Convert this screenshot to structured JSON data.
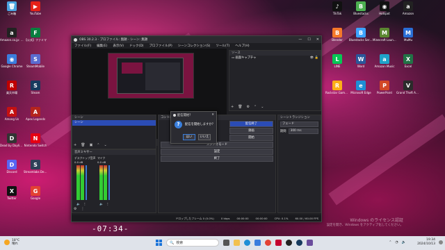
{
  "desktop": {
    "left_icons": [
      {
        "label": "ごみ箱",
        "color": "#4aa3df",
        "glyph": "🗑"
      },
      {
        "label": "YouTube",
        "color": "#e62117",
        "glyph": "▶"
      },
      {
        "label": "Amazon.co.jp: 暮らし",
        "color": "#222",
        "glyph": "a"
      },
      {
        "label": "【公式】ファミマ",
        "color": "#0a7f3f",
        "glyph": "F"
      },
      {
        "label": "Google Chrome",
        "color": "#3b7ddd",
        "glyph": "◉"
      },
      {
        "label": "SteamMobile",
        "color": "#5a6bd0",
        "glyph": "S"
      },
      {
        "label": "楽天市場",
        "color": "#bf0000",
        "glyph": "R"
      },
      {
        "label": "Steam",
        "color": "#173a5e",
        "glyph": "S"
      },
      {
        "label": "Among Us",
        "color": "#c51111",
        "glyph": "A"
      },
      {
        "label": "Apex Legends",
        "color": "#b5251d",
        "glyph": "A"
      },
      {
        "label": "Dead by Daylight",
        "color": "#333",
        "glyph": "D"
      },
      {
        "label": "Nintendo Switch",
        "color": "#e60012",
        "glyph": "N"
      },
      {
        "label": "Discord",
        "color": "#5865f2",
        "glyph": "D"
      },
      {
        "label": "Streamlabs Desktop",
        "color": "#2f4058",
        "glyph": "S"
      },
      {
        "label": "Twitter",
        "color": "#111",
        "glyph": "X"
      },
      {
        "label": "Google",
        "color": "#e34133",
        "glyph": "G"
      }
    ],
    "right_icons": [
      {
        "label": "TikTok",
        "color": "#111",
        "glyph": "♪"
      },
      {
        "label": "Bluestacks",
        "color": "#4caf50",
        "glyph": "B"
      },
      {
        "label": "Hotspot",
        "color": "#111",
        "glyph": "◉"
      },
      {
        "label": "Amazon",
        "color": "#222",
        "glyph": "a"
      },
      {
        "label": "Blender",
        "color": "#f5792a",
        "glyph": "B"
      },
      {
        "label": "Bluestacks Services",
        "color": "#3ca3ff",
        "glyph": "B"
      },
      {
        "label": "Minecraft Launcher",
        "color": "#5b8731",
        "glyph": "M"
      },
      {
        "label": "MuMu",
        "color": "#2a6fd6",
        "glyph": "M"
      },
      {
        "label": "LINE",
        "color": "#06c755",
        "glyph": "L"
      },
      {
        "label": "Word",
        "color": "#2b579a",
        "glyph": "W"
      },
      {
        "label": "Amazon Music",
        "color": "#1fa2c9",
        "glyph": "a"
      },
      {
        "label": "Excel",
        "color": "#217346",
        "glyph": "X"
      },
      {
        "label": "Rockstar Games Launcher",
        "color": "#fcaf17",
        "glyph": "R"
      },
      {
        "label": "Microsoft Edge",
        "color": "#1f8ed6",
        "glyph": "e"
      },
      {
        "label": "PowerPoint",
        "color": "#d24726",
        "glyph": "P"
      },
      {
        "label": "Grand Theft Auto V",
        "color": "#2b2b2b",
        "glyph": "V"
      }
    ],
    "clock_overlay": "-07:34-",
    "watermark_title": "Windows のライセンス認証",
    "watermark_sub": "設定を開き、Windows をアクティブ化してください。"
  },
  "obs": {
    "title": "OBS 30.2.3 - プロファイル: 無題 - シーン: 無題",
    "menu": [
      "ファイル(F)",
      "編集(E)",
      "表示(V)",
      "ドック(D)",
      "プロファイル(P)",
      "シーンコレクション(S)",
      "ツール(T)",
      "ヘルプ(H)"
    ],
    "source_bar_text": "ソースが選択されていません",
    "sources_panel": {
      "title": "ソース",
      "items": [
        "画面キャプチャ"
      ]
    },
    "scenes_panel": {
      "title": "シーン",
      "items": [
        "シーン"
      ]
    },
    "mixer_panel": {
      "title": "音声ミキサー",
      "channels": [
        {
          "name": "デスクトップ音声",
          "db": "0.0 dB"
        },
        {
          "name": "マイク",
          "db": "0.0 dB"
        }
      ]
    },
    "controls_panel": {
      "title": "コントロール",
      "buttons": [
        "配信終了",
        "録画",
        "開始",
        "スタジオモード",
        "設定",
        "終了"
      ]
    },
    "transitions_panel": {
      "title": "シーントランジション",
      "type": "フェード",
      "duration_label": "期間",
      "duration_value": "300 ms"
    },
    "status": {
      "frames": "ドロップしたフレーム 0 (0.0%)",
      "bitrate": "0 kbps",
      "live": "00:00:00",
      "rec": "00:00:00",
      "cpu": "CPU: 0.1%",
      "fps": "60.00 / 60.00 FPS"
    }
  },
  "dialog": {
    "title": "配信開始？",
    "message": "配信を開始しますか？",
    "yes": "はい",
    "no": "いいえ"
  },
  "taskbar": {
    "search_placeholder": "検索",
    "time": "19:34",
    "date": "2024/10/13",
    "weather_temp": "18°C",
    "weather_text": "晴れ"
  }
}
